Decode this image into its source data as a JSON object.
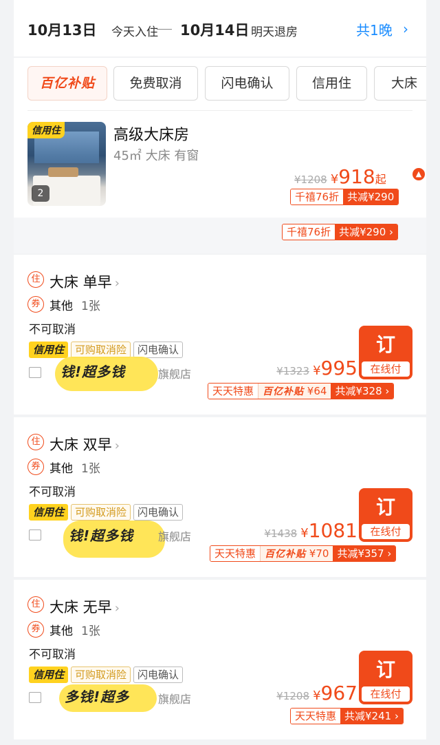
{
  "header": {
    "checkin_date": "10月13日",
    "checkin_label": "今天入住",
    "checkout_date": "10月14日",
    "checkout_label": "明天退房",
    "nights": "共1晚",
    "nights_chevron": "›"
  },
  "filters": [
    {
      "label": "百亿补贴",
      "brand": true
    },
    {
      "label": "免费取消"
    },
    {
      "label": "闪电确认"
    },
    {
      "label": "信用住"
    },
    {
      "label": "大床"
    }
  ],
  "room": {
    "image_tag": "信用住",
    "image_count": "2",
    "title": "高级大床房",
    "subtitle": "45㎡  大床  有窗",
    "original_price": "¥1208",
    "currency": "¥",
    "price": "918",
    "price_suffix": "起",
    "discount_left": "千禧76折",
    "discount_right": "共减¥290"
  },
  "sticky_discount": {
    "left": "千禧76折",
    "right": "共减¥290 ›"
  },
  "offers": [
    {
      "badge_stay": "住",
      "title": "大床  单早",
      "chevron": "›",
      "badge_coupon": "券",
      "bed": "其他",
      "bed_count": "1张",
      "cancel": "不可取消",
      "tag_credit": "信用住",
      "tag_insurance": "可购取消险",
      "tag_flash": "闪电确认",
      "scribble_text": "钱!超多钱",
      "shop_suffix": "旗舰店",
      "original_price": "¥1323",
      "currency": "¥",
      "price": "995",
      "book_label": "订",
      "pay_label": "在线付",
      "disc_left": "天天特惠",
      "disc_mid_brand": "百亿补贴",
      "disc_mid_value": "¥64",
      "disc_right": "共减¥328 ›"
    },
    {
      "badge_stay": "住",
      "title": "大床  双早",
      "chevron": "›",
      "badge_coupon": "券",
      "bed": "其他",
      "bed_count": "1张",
      "cancel": "不可取消",
      "tag_credit": "信用住",
      "tag_insurance": "可购取消险",
      "tag_flash": "闪电确认",
      "scribble_text": "钱!超多钱",
      "shop_suffix": "旗舰店",
      "original_price": "¥1438",
      "currency": "¥",
      "price": "1081",
      "book_label": "订",
      "pay_label": "在线付",
      "disc_left": "天天特惠",
      "disc_mid_brand": "百亿补贴",
      "disc_mid_value": "¥70",
      "disc_right": "共减¥357 ›"
    },
    {
      "badge_stay": "住",
      "title": "大床  无早",
      "chevron": "›",
      "badge_coupon": "券",
      "bed": "其他",
      "bed_count": "1张",
      "cancel": "不可取消",
      "tag_credit": "信用住",
      "tag_insurance": "可购取消险",
      "tag_flash": "闪电确认",
      "scribble_text": "多钱!超多",
      "shop_suffix": "旗舰店",
      "original_price": "¥1208",
      "currency": "¥",
      "price": "967",
      "book_label": "订",
      "pay_label": "在线付",
      "disc_left": "天天特惠",
      "disc_right": "共减¥241 ›"
    }
  ],
  "colors": {
    "accent": "#f04a1a",
    "link": "#1a8cff",
    "credit_yellow": "#ffd21f"
  }
}
